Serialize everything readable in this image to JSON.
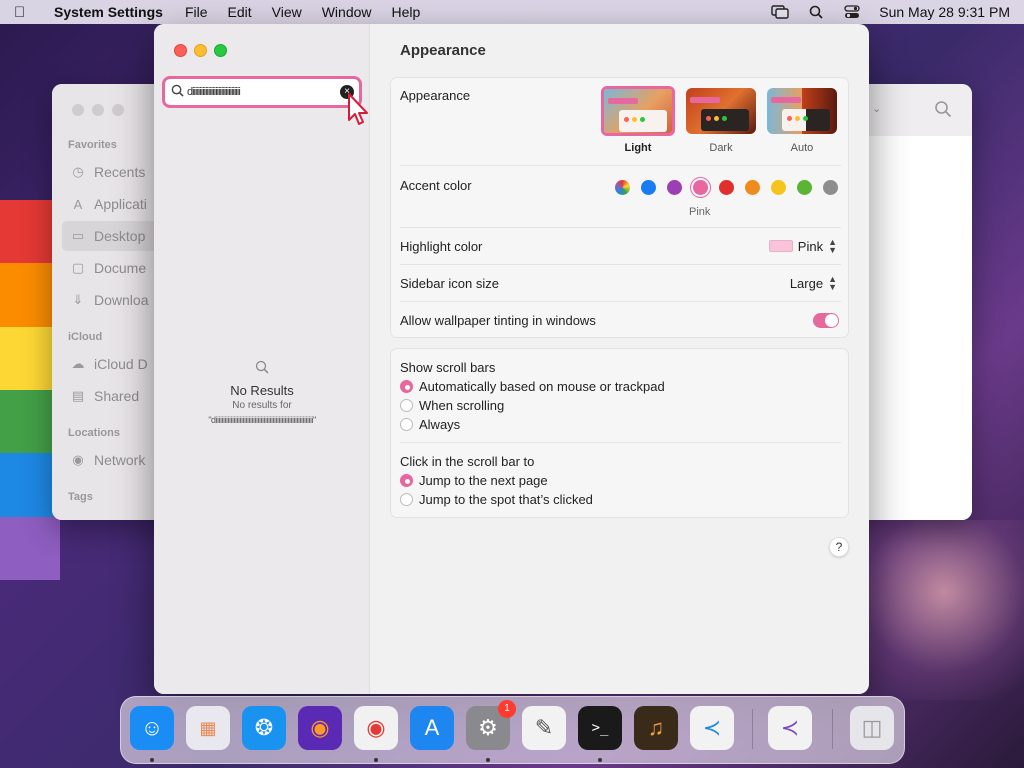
{
  "menubar": {
    "app_name": "System Settings",
    "menus": [
      "File",
      "Edit",
      "View",
      "Window",
      "Help"
    ],
    "datetime": "Sun May 28  9:31 PM"
  },
  "finder": {
    "sections": {
      "favorites": "Favorites",
      "icloud": "iCloud",
      "locations": "Locations",
      "tags": "Tags"
    },
    "items": [
      {
        "label": "Recents",
        "icon": "clock-icon"
      },
      {
        "label": "Applicati",
        "icon": "apps-icon"
      },
      {
        "label": "Desktop",
        "icon": "desktop-icon"
      },
      {
        "label": "Docume",
        "icon": "document-icon"
      },
      {
        "label": "Downloa",
        "icon": "download-icon"
      },
      {
        "label": "iCloud D",
        "icon": "cloud-icon"
      },
      {
        "label": "Shared",
        "icon": "folder-icon"
      },
      {
        "label": "Network",
        "icon": "globe-icon"
      }
    ]
  },
  "search": {
    "value": "diiiiiiiiiiiiiiiiiiiiiiiiiiiiiiiii"
  },
  "no_results": {
    "title": "No Results",
    "subtitle": "No results for",
    "query": "\"diiiiiiiiiiiiiiiiiiiiiiiiiiiiiiiiiiiiiiiiiiiiiiiiiiiiiiiiiiiiiiiii\""
  },
  "main": {
    "title": "Appearance",
    "appearance": {
      "label": "Appearance",
      "options": [
        "Light",
        "Dark",
        "Auto"
      ],
      "selected": "Light"
    },
    "accent": {
      "label": "Accent color",
      "colors": [
        "#8a8aff",
        "#1a7cf2",
        "#9b3fb5",
        "#e7679f",
        "#e0302e",
        "#f08a1e",
        "#f5c51e",
        "#5bb534",
        "#8e8e8e"
      ],
      "selected_name": "Pink"
    },
    "highlight": {
      "label": "Highlight color",
      "value": "Pink"
    },
    "sidebar_icon": {
      "label": "Sidebar icon size",
      "value": "Large"
    },
    "tinting": {
      "label": "Allow wallpaper tinting in windows",
      "enabled": true
    },
    "scrollbars": {
      "label": "Show scroll bars",
      "options": [
        "Automatically based on mouse or trackpad",
        "When scrolling",
        "Always"
      ],
      "selected": 0
    },
    "click_scroll": {
      "label": "Click in the scroll bar to",
      "options": [
        "Jump to the next page",
        "Jump to the spot that’s clicked"
      ],
      "selected": 0
    },
    "help": "?"
  },
  "dock": {
    "apps": [
      {
        "name": "Finder",
        "color": "#1a8cf5",
        "running": true
      },
      {
        "name": "Launchpad",
        "color": "#e8e8ee",
        "running": false
      },
      {
        "name": "Safari",
        "color": "#1a92f0",
        "running": false
      },
      {
        "name": "Firefox",
        "color": "#5a2ab5",
        "running": false
      },
      {
        "name": "Chrome",
        "color": "#f1f1f1",
        "running": true
      },
      {
        "name": "App Store",
        "color": "#1e86f0",
        "running": false
      },
      {
        "name": "System Settings",
        "color": "#8a8a8e",
        "running": true,
        "badge": "1"
      },
      {
        "name": "TextEdit",
        "color": "#f2f2f2",
        "running": false
      },
      {
        "name": "Terminal",
        "color": "#1a1a1a",
        "running": true
      },
      {
        "name": "GarageBand",
        "color": "#3a2a1a",
        "running": false
      },
      {
        "name": "VS Code",
        "color": "#f2f2f2",
        "running": false
      },
      {
        "name": "Visual Studio",
        "color": "#f2f2f2",
        "running": false
      },
      {
        "name": "Trash",
        "color": "#e6e6ea",
        "running": false
      }
    ]
  }
}
